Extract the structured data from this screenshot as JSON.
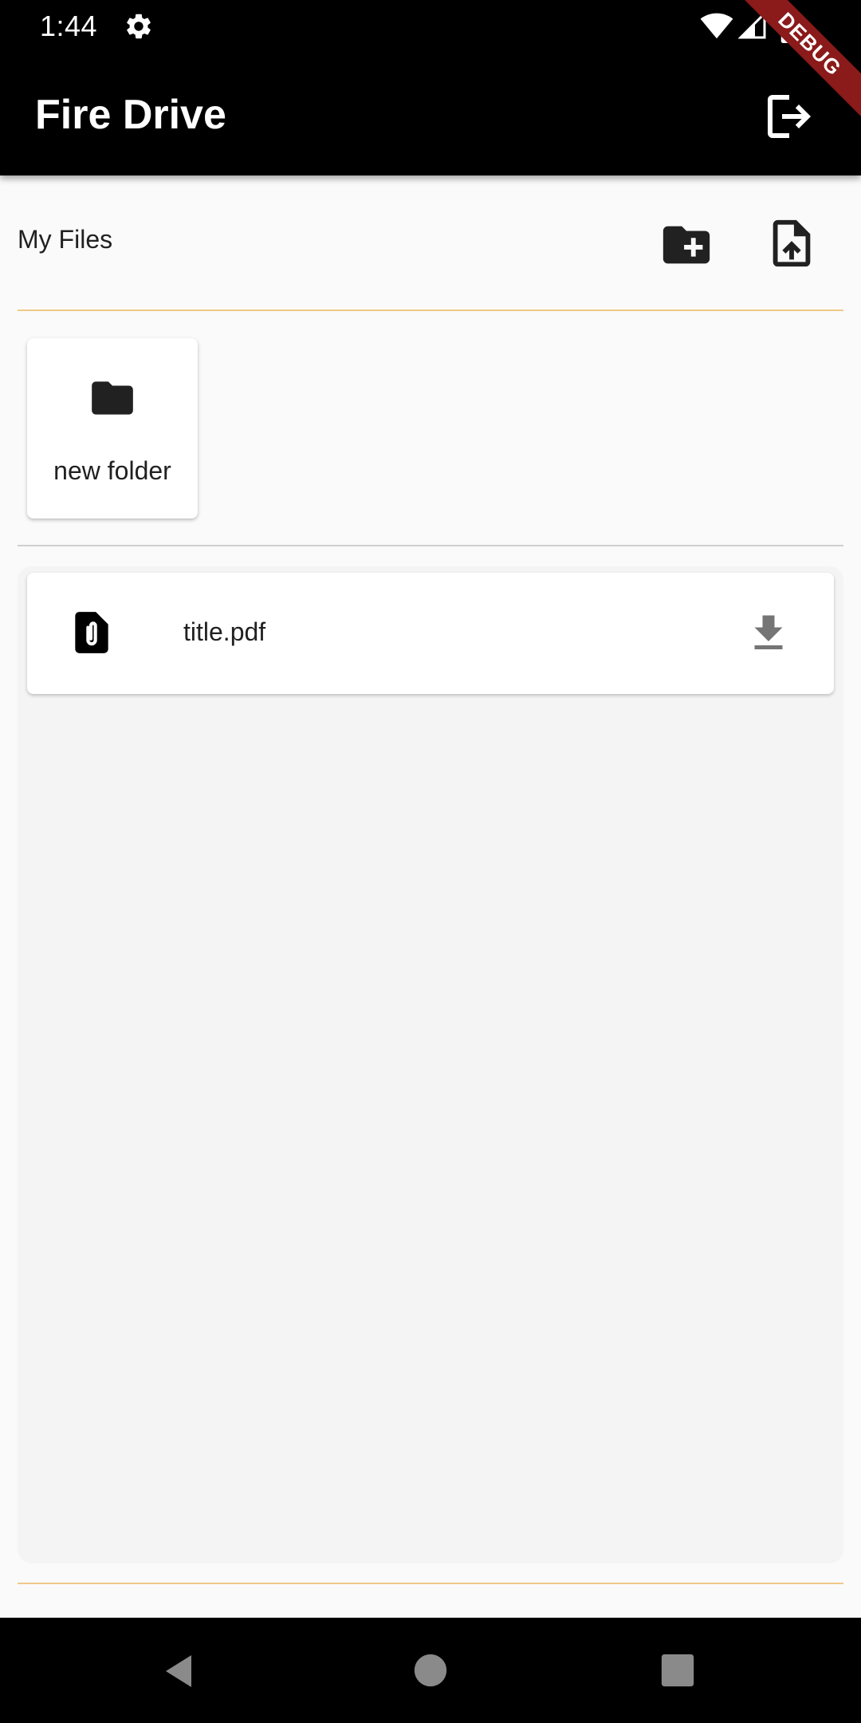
{
  "status_bar": {
    "time": "1:44",
    "icons": [
      "gear-icon",
      "wifi-icon",
      "signal-icon",
      "battery-icon"
    ]
  },
  "app_bar": {
    "title": "Fire Drive",
    "logout_icon": "logout-icon",
    "background": "#000000"
  },
  "debug_banner": {
    "label": "DEBUG",
    "color": "#8b1a1a"
  },
  "files_header": {
    "title": "My Files",
    "create_folder_icon": "create-new-folder-icon",
    "upload_file_icon": "upload-file-icon"
  },
  "folders": [
    {
      "name": "new folder",
      "icon": "folder-icon"
    }
  ],
  "files": [
    {
      "name": "title.pdf",
      "icon": "file-attachment-icon",
      "action_icon": "download-icon"
    }
  ],
  "colors": {
    "accent_divider": "#f0c987",
    "page_background": "#fafafa",
    "panel_background": "#f4f4f4"
  },
  "nav_bar": {
    "icons": [
      "back-icon",
      "home-icon",
      "recents-icon"
    ]
  }
}
